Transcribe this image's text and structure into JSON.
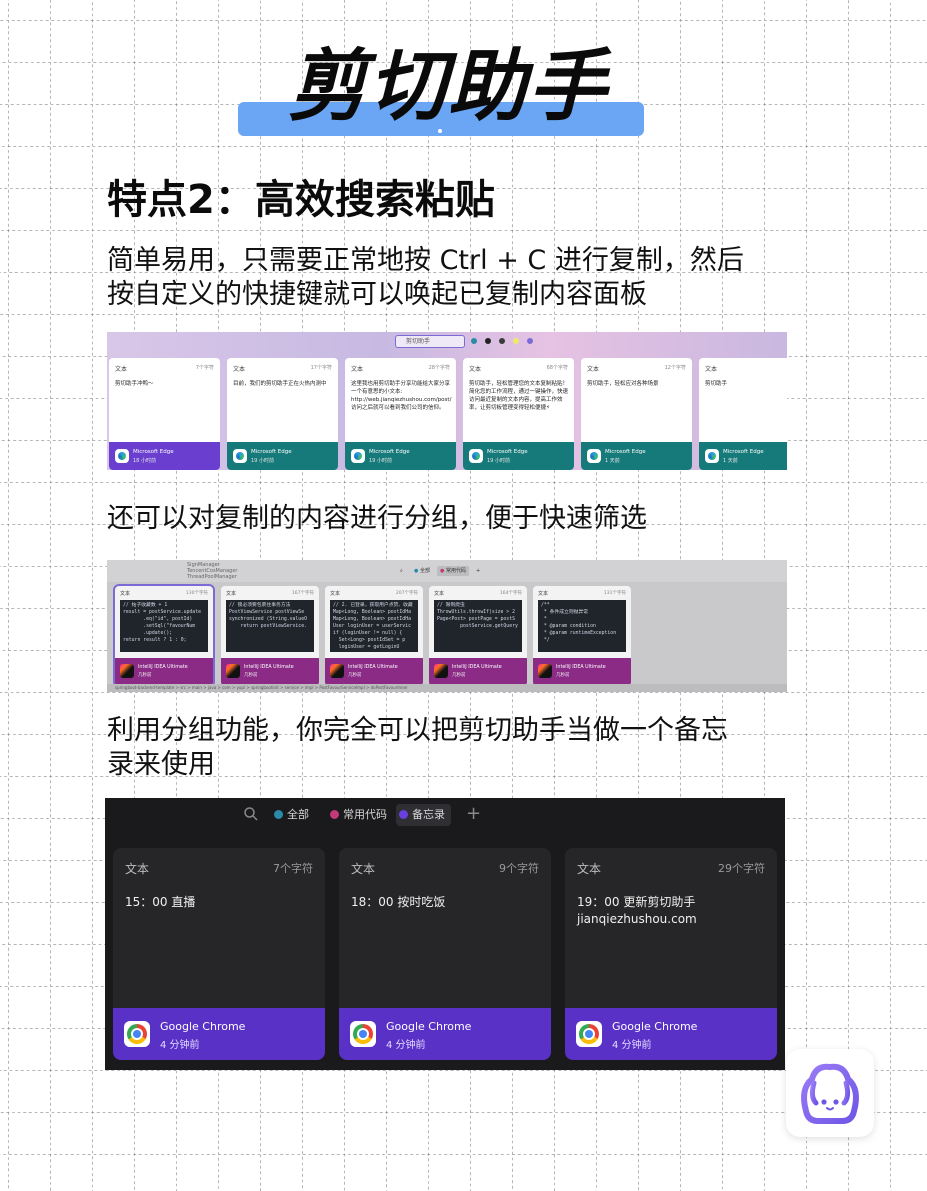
{
  "title": "剪切助手",
  "section_title": "特点2：高效搜索粘贴",
  "paragraphs": {
    "p1_line1": "简单易用，只需要正常地按 Ctrl + C 进行复制，然后",
    "p1_line2": "按自定义的快捷键就可以唤起已复制内容面板",
    "p2": "还可以对复制的内容进行分组，便于快速筛选",
    "p3_line1": "利用分组功能，你完全可以把剪切助手当做一个备忘",
    "p3_line2": "录来使用"
  },
  "shot1": {
    "search_placeholder": "剪切助手",
    "dots": [
      "#2b8aa6",
      "#222222",
      "#3a3a3a",
      "#ece96b",
      "#7b6bd6"
    ],
    "cards": [
      {
        "type": "文本",
        "count": "7个字符",
        "body": "剪切助手冲鸭～",
        "app": "Microsoft Edge",
        "time": "18 小时前",
        "foot_color": "#6a3fd0"
      },
      {
        "type": "文本",
        "count": "17个字符",
        "body": "目前，我们的剪切助手正在火热内测中",
        "app": "Microsoft Edge",
        "time": "19 小时前",
        "foot_color": "#177a7a"
      },
      {
        "type": "文本",
        "count": "28个字符",
        "body": "这里我也用剪切助手分享功能给大家分享一个有意思的小文本: http://web.jianqiezhushou.com/post/ 访问之后就可以看到我们公司的信仰。",
        "app": "Microsoft Edge",
        "time": "19 小时前",
        "foot_color": "#177a7a"
      },
      {
        "type": "文本",
        "count": "68个字符",
        "body": "剪切助手，轻松管理您的文本复制粘贴！简化您的工作流程，通过一键操作，快速访问最近复制的文本内容，提高工作效率，让剪切板管理变得轻松便捷⚡",
        "app": "Microsoft Edge",
        "time": "19 小时前",
        "foot_color": "#177a7a"
      },
      {
        "type": "文本",
        "count": "12个字符",
        "body": "剪切助手，轻松应对各种场景",
        "app": "Microsoft Edge",
        "time": "1 天前",
        "foot_color": "#177a7a"
      },
      {
        "type": "文本",
        "count": "4",
        "body": "剪切助手",
        "app": "Microsoft Edge",
        "time": "1 天前",
        "foot_color": "#177a7a"
      }
    ]
  },
  "shot2": {
    "side_items": [
      "SignManager",
      "TencentCosManager",
      "ThreadPoolManager"
    ],
    "tabs": [
      "全部",
      "常用代码"
    ],
    "cards": [
      {
        "type": "文本",
        "count": "130个字符",
        "code": "// 帖子收藏数 + 1\nresult = postService.update\n       .eq(\"id\", postId)\n       .setSql(\"favourNum\n       .update();\nreturn result ? 1 : 0;",
        "app": "IntelliJ IDEA Ultimate",
        "time": "几秒前"
      },
      {
        "type": "文本",
        "count": "167个字符",
        "code": "// 锁必须要包裹住事务方法\nPostViewService postViewSe\nsynchronized (String.valueO\n    return postViewService.",
        "app": "IntelliJ IDEA Ultimate",
        "time": "几秒前"
      },
      {
        "type": "文本",
        "count": "207个字符",
        "code": "// 2. 已登录，获取用户点赞、收藏\nMap<Long, Boolean> postIdHa\nMap<Long, Boolean> postIdHa\nUser loginUser = userServic\nif (loginUser != null) {\n  Set<Long> postIdSet = p\n  loginUser = getLoginU",
        "app": "IntelliJ IDEA Ultimate",
        "time": "几秒前"
      },
      {
        "type": "文本",
        "count": "164个字符",
        "code": "// 限制爬虫\nThrowUtils.throwIf(size > 2\nPage<Post> postPage = postS\n        postService.getQuery",
        "app": "IntelliJ IDEA Ultimate",
        "time": "几秒前"
      },
      {
        "type": "文本",
        "count": "131个字符",
        "code": "/**\n * 条件成立则抛异常\n *\n * @param condition\n * @param runtimeException\n */",
        "app": "IntelliJ IDEA Ultimate",
        "time": "几秒前"
      }
    ],
    "status_text": "springboot-backend-template > src > main > java > com > yupi > springbootinit > service > impl > PostFavourServiceImpl > doPostFavourInner"
  },
  "shot3": {
    "tabs": [
      {
        "label": "全部",
        "color": "#2b8aa6"
      },
      {
        "label": "常用代码",
        "color": "#c23a7a"
      },
      {
        "label": "备忘录",
        "color": "#6a3fe0"
      }
    ],
    "plus": "+",
    "cards": [
      {
        "type": "文本",
        "count": "7个字符",
        "body": "15：00 直播",
        "app": "Google Chrome",
        "time": "4 分钟前"
      },
      {
        "type": "文本",
        "count": "9个字符",
        "body": "18：00 按时吃饭",
        "app": "Google Chrome",
        "time": "4 分钟前"
      },
      {
        "type": "文本",
        "count": "29个字符",
        "body": "19：00 更新剪切助手\njianqiezhushou.com",
        "app": "Google Chrome",
        "time": "4 分钟前"
      }
    ]
  },
  "colors": {
    "title_bar": "#6aa6f3",
    "mascot_purple": "#8b6cf0"
  }
}
